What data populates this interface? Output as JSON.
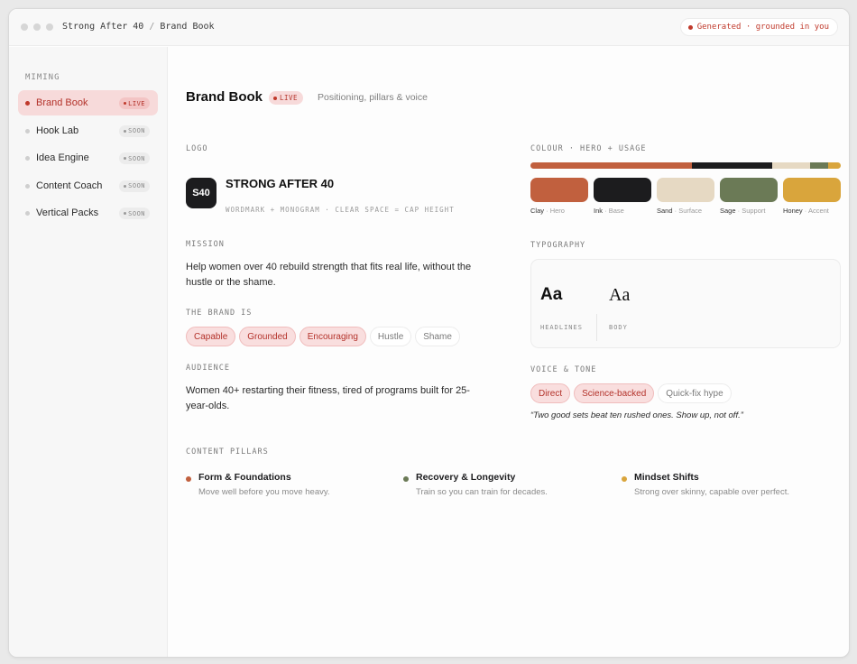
{
  "titlebar": {
    "breadcrumb": [
      "Strong After 40",
      "Brand Book"
    ],
    "status": "Generated · grounded in you"
  },
  "sidebar": {
    "heading": "MIMING",
    "items": [
      {
        "label": "Brand Book",
        "tag": "LIVE",
        "active": true
      },
      {
        "label": "Hook Lab",
        "tag": "SOON",
        "active": false
      },
      {
        "label": "Idea Engine",
        "tag": "SOON",
        "active": false
      },
      {
        "label": "Content Coach",
        "tag": "SOON",
        "active": false
      },
      {
        "label": "Vertical Packs",
        "tag": "SOON",
        "active": false
      }
    ]
  },
  "header": {
    "title": "Brand Book",
    "badge": "LIVE",
    "subtitle": "Positioning, pillars & voice"
  },
  "logo": {
    "label": "LOGO",
    "monogram": "S40",
    "wordmark": "STRONG AFTER 40",
    "meta": "WORDMARK + MONOGRAM · CLEAR SPACE = CAP HEIGHT"
  },
  "mission": {
    "label": "MISSION",
    "text": "Help women over 40 rebuild strength that fits real life, without the hustle or the shame."
  },
  "brand_is": {
    "label": "THE BRAND IS",
    "chips": [
      {
        "text": "Capable",
        "on": true
      },
      {
        "text": "Grounded",
        "on": true
      },
      {
        "text": "Encouraging",
        "on": true
      },
      {
        "text": "Hustle",
        "on": false
      },
      {
        "text": "Shame",
        "on": false
      }
    ]
  },
  "audience": {
    "label": "AUDIENCE",
    "text": "Women 40+ restarting their fitness, tired of programs built for 25-year-olds."
  },
  "colour": {
    "label": "COLOUR · HERO + USAGE",
    "usage": [
      {
        "color": "#c1603e",
        "share": 0.52
      },
      {
        "color": "#1c1c1e",
        "share": 0.26
      },
      {
        "color": "#e6d9c3",
        "share": 0.12
      },
      {
        "color": "#6b7a56",
        "share": 0.06
      },
      {
        "color": "#d9a53c",
        "share": 0.04
      }
    ],
    "swatches": [
      {
        "name": "Clay",
        "role": "Hero",
        "color": "#c1603e"
      },
      {
        "name": "Ink",
        "role": "Base",
        "color": "#1c1c1e"
      },
      {
        "name": "Sand",
        "role": "Surface",
        "color": "#e6d9c3"
      },
      {
        "name": "Sage",
        "role": "Support",
        "color": "#6b7a56"
      },
      {
        "name": "Honey",
        "role": "Accent",
        "color": "#d9a53c"
      }
    ]
  },
  "typography": {
    "label": "TYPOGRAPHY",
    "headline_sample": "Aa",
    "headline_caption": "HEADLINES",
    "body_sample": "Aa",
    "body_caption": "BODY"
  },
  "voice": {
    "label": "VOICE & TONE",
    "chips": [
      {
        "text": "Direct",
        "on": true
      },
      {
        "text": "Science-backed",
        "on": true
      },
      {
        "text": "Quick-fix hype",
        "on": false
      }
    ],
    "quote": "“Two good sets beat ten rushed ones. Show up, not off.”"
  },
  "pillars": {
    "label": "CONTENT PILLARS",
    "items": [
      {
        "title": "Form & Foundations",
        "desc": "Move well before you move heavy.",
        "color": "#c1603e"
      },
      {
        "title": "Recovery & Longevity",
        "desc": "Train so you can train for decades.",
        "color": "#6b7a56"
      },
      {
        "title": "Mindset Shifts",
        "desc": "Strong over skinny, capable over perfect.",
        "color": "#d9a53c"
      }
    ]
  }
}
